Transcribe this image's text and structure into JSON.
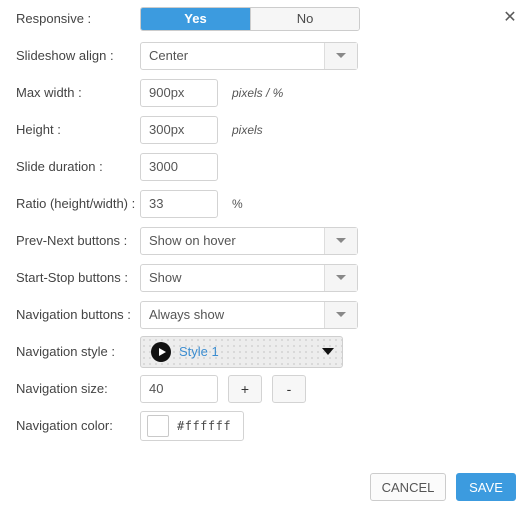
{
  "dialog": {
    "close_icon": "close-icon"
  },
  "rows": {
    "responsive": {
      "label": "Responsive :",
      "yes": "Yes",
      "no": "No",
      "selected": "Yes"
    },
    "slideshow_align": {
      "label": "Slideshow align :",
      "value": "Center"
    },
    "max_width": {
      "label": "Max width :",
      "value": "900px",
      "unit": "pixels / %"
    },
    "height": {
      "label": "Height :",
      "value": "300px",
      "unit": "pixels"
    },
    "slide_duration": {
      "label": "Slide duration :",
      "value": "3000"
    },
    "ratio": {
      "label": "Ratio (height/width) :",
      "value": "33",
      "unit": "%"
    },
    "prev_next_buttons": {
      "label": "Prev-Next buttons :",
      "value": "Show on hover"
    },
    "start_stop_buttons": {
      "label": "Start-Stop buttons :",
      "value": "Show"
    },
    "navigation_buttons": {
      "label": "Navigation buttons :",
      "value": "Always show"
    },
    "navigation_style": {
      "label": "Navigation style :",
      "value": "Style 1",
      "icon": "play-circle-icon"
    },
    "navigation_size": {
      "label": "Navigation size:",
      "value": "40",
      "plus": "+",
      "minus": "-"
    },
    "navigation_color": {
      "label": "Navigation color:",
      "value": "#ffffff",
      "swatch_color": "#ffffff"
    }
  },
  "footer": {
    "cancel": "CANCEL",
    "save": "SAVE"
  },
  "colors": {
    "accent_blue": "#3c9bdf",
    "link_blue": "#3c8dd0",
    "text": "#444444"
  }
}
